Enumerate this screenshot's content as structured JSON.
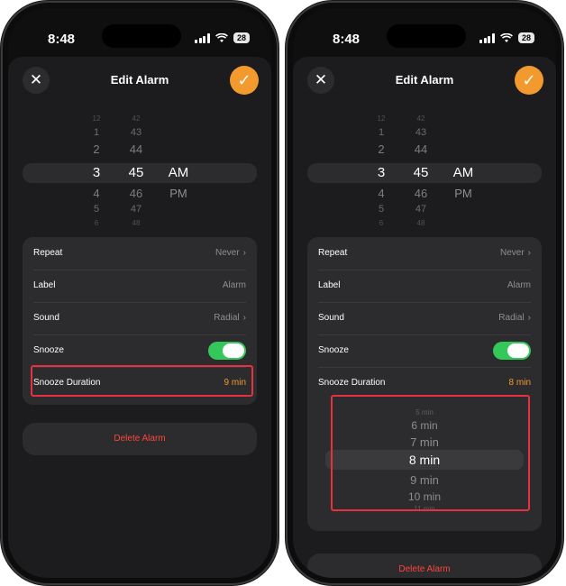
{
  "status": {
    "time": "8:48",
    "battery": "28"
  },
  "screens": [
    {
      "title": "Edit Alarm",
      "close_icon": "✕",
      "save_icon": "✓",
      "picker": {
        "hours": [
          "12",
          "1",
          "2",
          "3",
          "4",
          "5",
          "6"
        ],
        "minutes": [
          "42",
          "43",
          "44",
          "45",
          "46",
          "47",
          "48"
        ],
        "ampm": [
          "AM",
          "PM"
        ],
        "selected": {
          "hour": "3",
          "minute": "45",
          "period": "AM"
        }
      },
      "rows": [
        {
          "label": "Repeat",
          "value": "Never"
        },
        {
          "label": "Label",
          "value": "Alarm"
        },
        {
          "label": "Sound",
          "value": "Radial"
        },
        {
          "label": "Snooze",
          "value": "on"
        },
        {
          "label": "Snooze Duration",
          "value": "9 min"
        }
      ],
      "delete_label": "Delete Alarm"
    },
    {
      "title": "Edit Alarm",
      "close_icon": "✕",
      "save_icon": "✓",
      "picker": {
        "hours": [
          "12",
          "1",
          "2",
          "3",
          "4",
          "5",
          "6"
        ],
        "minutes": [
          "42",
          "43",
          "44",
          "45",
          "46",
          "47",
          "48"
        ],
        "ampm": [
          "AM",
          "PM"
        ],
        "selected": {
          "hour": "3",
          "minute": "45",
          "period": "AM"
        }
      },
      "rows": [
        {
          "label": "Repeat",
          "value": "Never"
        },
        {
          "label": "Label",
          "value": "Alarm"
        },
        {
          "label": "Sound",
          "value": "Radial"
        },
        {
          "label": "Snooze",
          "value": "on"
        },
        {
          "label": "Snooze Duration",
          "value": "8 min"
        }
      ],
      "snooze_options": [
        "5 min",
        "6 min",
        "7 min",
        "8 min",
        "9 min",
        "10 min",
        "11 min"
      ],
      "delete_label": "Delete Alarm"
    }
  ],
  "colors": {
    "accent": "#f29a2e",
    "destructive": "#ff453a",
    "toggle_on": "#34c759",
    "highlight": "#e8313f"
  }
}
